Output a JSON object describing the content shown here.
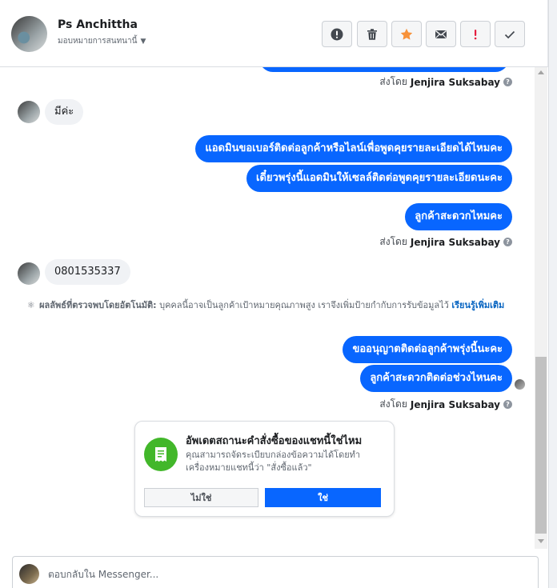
{
  "header": {
    "contact_name": "Ps Anchittha",
    "assign_label": "มอบหมายการสนทนานี้",
    "actions": [
      {
        "name": "mark-spam-button",
        "icon": "alert-circle-icon"
      },
      {
        "name": "delete-button",
        "icon": "trash-icon"
      },
      {
        "name": "star-button",
        "icon": "star-icon"
      },
      {
        "name": "mark-unread-button",
        "icon": "envelope-icon"
      },
      {
        "name": "follow-up-button",
        "icon": "exclamation-icon"
      },
      {
        "name": "mark-done-button",
        "icon": "check-icon"
      }
    ],
    "accent_color": "#f7923a",
    "spam_color": "#e41e3f"
  },
  "thread": {
    "sent_by_prefix": "ส่งโดย",
    "agent_name": "Jenjira Suksabay",
    "messages": [
      {
        "direction": "in",
        "text": "มีค่ะ"
      },
      {
        "direction": "out",
        "text": "แอดมินขอเบอร์ติดต่อลูกค้าหรือไลน์เพื่อพูดคุยรายละเอียดได้ไหมคะ"
      },
      {
        "direction": "out",
        "text": "เดี๋ยวพรุ่งนี้แอดมินให้เซลล์ติดต่อพูดคุยรายละเอียดนะคะ"
      },
      {
        "direction": "out",
        "text": "ลูกค้าสะดวกไหมคะ"
      },
      {
        "direction": "in",
        "text": "0801535337"
      },
      {
        "direction": "out",
        "text": "ขออนุญาตติดต่อลูกค้าพรุ่งนี้นะคะ"
      },
      {
        "direction": "out",
        "text": "ลูกค้าสะดวกติดต่อช่วงไหนคะ"
      }
    ],
    "auto_detect": {
      "label": "ผลลัพธ์ที่ตรวจพบโดยอัตโนมัติ:",
      "text": "บุคคลนี้อาจเป็นลูกค้าเป้าหมายคุณภาพสูง เราจึงเพิ่มป้ายกำกับการรับข้อมูลไว้",
      "link": "เรียนรู้เพิ่มเติม"
    },
    "bubble_color": "#0866ff"
  },
  "order_card": {
    "title": "อัพเดตสถานะคำสั่งซื้อของแชทนี้ใช่ไหม",
    "description": "คุณสามารถจัดระเบียบกล่องข้อความได้โดยทำเครื่องหมายแชทนี้ว่า \"สั่งซื้อแล้ว\"",
    "no_label": "ไม่ใช่",
    "yes_label": "ใช่",
    "icon": "receipt-icon",
    "icon_color": "#42b72a"
  },
  "composer": {
    "placeholder": "ตอบกลับใน Messenger..."
  }
}
